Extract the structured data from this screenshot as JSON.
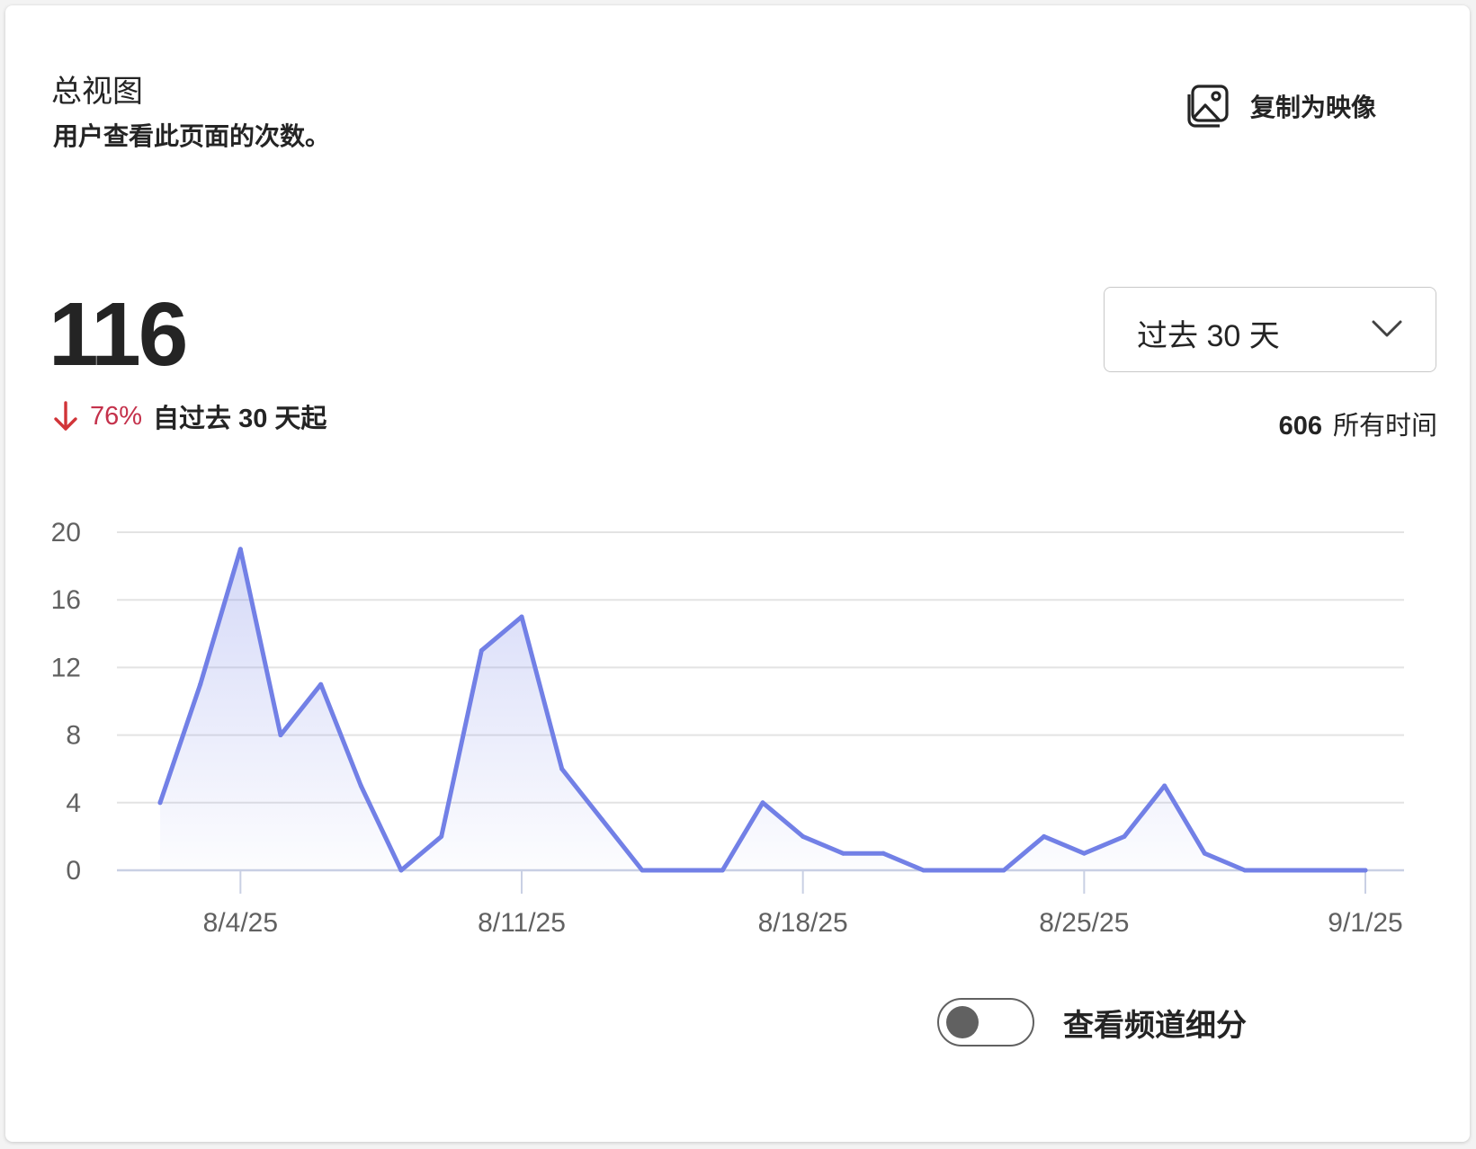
{
  "card": {
    "title": "总视图",
    "subtitle": "用户查看此页面的次数。",
    "copy_button_label": "复制为映像",
    "copy_icon": "image-icon"
  },
  "summary": {
    "total": "116",
    "trend_direction_icon": "arrow-down-icon",
    "trend_percent": "76%",
    "trend_text": "自过去 30 天起",
    "trend_color": "#c4314b",
    "alltime_value": "606",
    "alltime_label": "所有时间"
  },
  "period_dropdown": {
    "selected": "过去 30 天",
    "icon": "chevron-down-icon"
  },
  "chart_data": {
    "type": "area",
    "x": [
      "8/2/25",
      "8/3/25",
      "8/4/25",
      "8/5/25",
      "8/6/25",
      "8/7/25",
      "8/8/25",
      "8/9/25",
      "8/10/25",
      "8/11/25",
      "8/12/25",
      "8/13/25",
      "8/14/25",
      "8/15/25",
      "8/16/25",
      "8/17/25",
      "8/18/25",
      "8/19/25",
      "8/20/25",
      "8/21/25",
      "8/22/25",
      "8/23/25",
      "8/24/25",
      "8/25/25",
      "8/26/25",
      "8/27/25",
      "8/28/25",
      "8/29/25",
      "8/30/25",
      "8/31/25",
      "9/1/25"
    ],
    "series": [
      {
        "values": [
          4,
          11,
          19,
          8,
          11,
          5,
          0,
          2,
          13,
          15,
          6,
          3,
          0,
          0,
          0,
          4,
          2,
          1,
          1,
          0,
          0,
          0,
          2,
          1,
          2,
          5,
          1,
          0,
          0,
          0,
          0
        ]
      }
    ],
    "x_tick_labels": [
      "8/4/25",
      "8/11/25",
      "8/18/25",
      "8/25/25",
      "9/1/25"
    ],
    "y_tick_labels": [
      "0",
      "4",
      "8",
      "12",
      "16",
      "20"
    ],
    "ylim": [
      0,
      20
    ],
    "grid": true,
    "line_color": "#7280e6"
  },
  "breakdown_toggle": {
    "label": "查看频道细分",
    "state": "off"
  }
}
